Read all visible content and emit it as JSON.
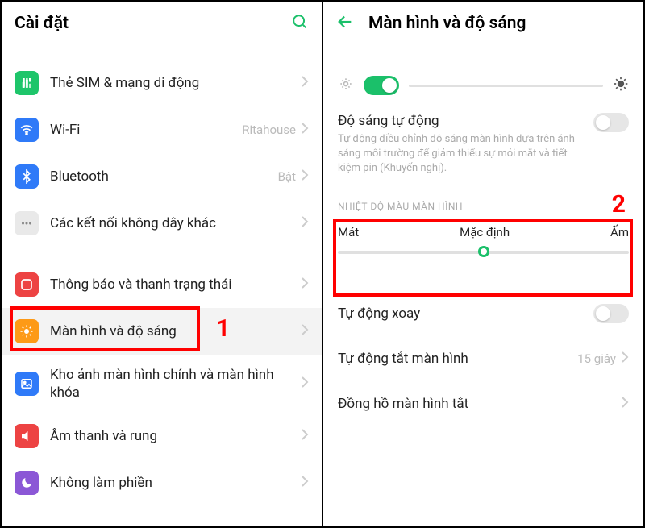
{
  "left": {
    "title": "Cài đặt",
    "items": {
      "sim": {
        "label": "Thẻ SIM & mạng di động"
      },
      "wifi": {
        "label": "Wi-Fi",
        "value": "Ritahouse"
      },
      "bt": {
        "label": "Bluetooth",
        "value": "Bật"
      },
      "more": {
        "label": "Các kết nối không dây khác"
      },
      "notif": {
        "label": "Thông báo và thanh trạng thái"
      },
      "display": {
        "label": "Màn hình và độ sáng"
      },
      "gallery": {
        "label": "Kho ảnh màn hình chính và màn hình khóa"
      },
      "sound": {
        "label": "Âm thanh và rung"
      },
      "dnd": {
        "label": "Không làm phiền"
      }
    },
    "annotation": "1"
  },
  "right": {
    "title": "Màn hình và độ sáng",
    "auto_brightness": {
      "title": "Độ sáng tự động",
      "desc": "Tự động điều chỉnh độ sáng màn hình dựa trên ánh sáng môi trường để giảm thiểu sự mỏi mắt và tiết kiệm pin (Khuyến nghị).",
      "enabled": false
    },
    "brightness_toggle": true,
    "temp": {
      "header": "NHIỆT ĐỘ MÀU MÀN HÌNH",
      "cool": "Mát",
      "default": "Mặc định",
      "warm": "Ấm"
    },
    "rotate": {
      "label": "Tự động xoay",
      "enabled": false
    },
    "timeout": {
      "label": "Tự động tắt màn hình",
      "value": "15 giây"
    },
    "aod": {
      "label": "Đồng hồ màn hình tắt"
    },
    "annotation": "2"
  }
}
